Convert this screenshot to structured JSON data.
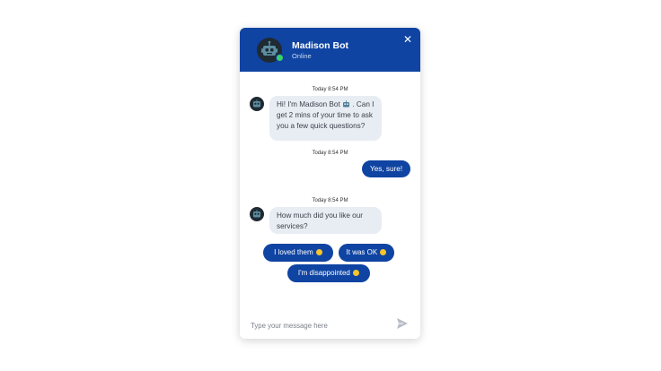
{
  "header": {
    "name": "Madison Bot",
    "status": "Online",
    "close_glyph": "✕",
    "avatar_icon": "robot-icon"
  },
  "conversation": {
    "messages": [
      {
        "timestamp": "Today 8:54 PM",
        "from": "bot",
        "text": "Hi! I'm Madison Bot",
        "emoji_icon": "robot-icon",
        "text_after": ". Can I get 2 mins of your time to ask you a few quick questions?"
      },
      {
        "timestamp": "Today 8:54 PM",
        "from": "user",
        "text": "Yes, sure!"
      },
      {
        "timestamp": "Today 8:54 PM",
        "from": "bot",
        "text": "How much did you like our services?"
      }
    ],
    "quick_replies": [
      {
        "label": "I loved them",
        "emoji_icon": "heart-eyes-emoji-icon"
      },
      {
        "label": "It was OK",
        "emoji_icon": "slight-smile-emoji-icon"
      },
      {
        "label": "I'm disappointed",
        "emoji_icon": "disappointed-emoji-icon"
      }
    ]
  },
  "composer": {
    "placeholder": "Type your message here",
    "send_icon": "send-icon"
  },
  "colors": {
    "brand": "#0f44a2",
    "bot_bubble": "#e8ecf3",
    "online": "#3ad06a"
  }
}
